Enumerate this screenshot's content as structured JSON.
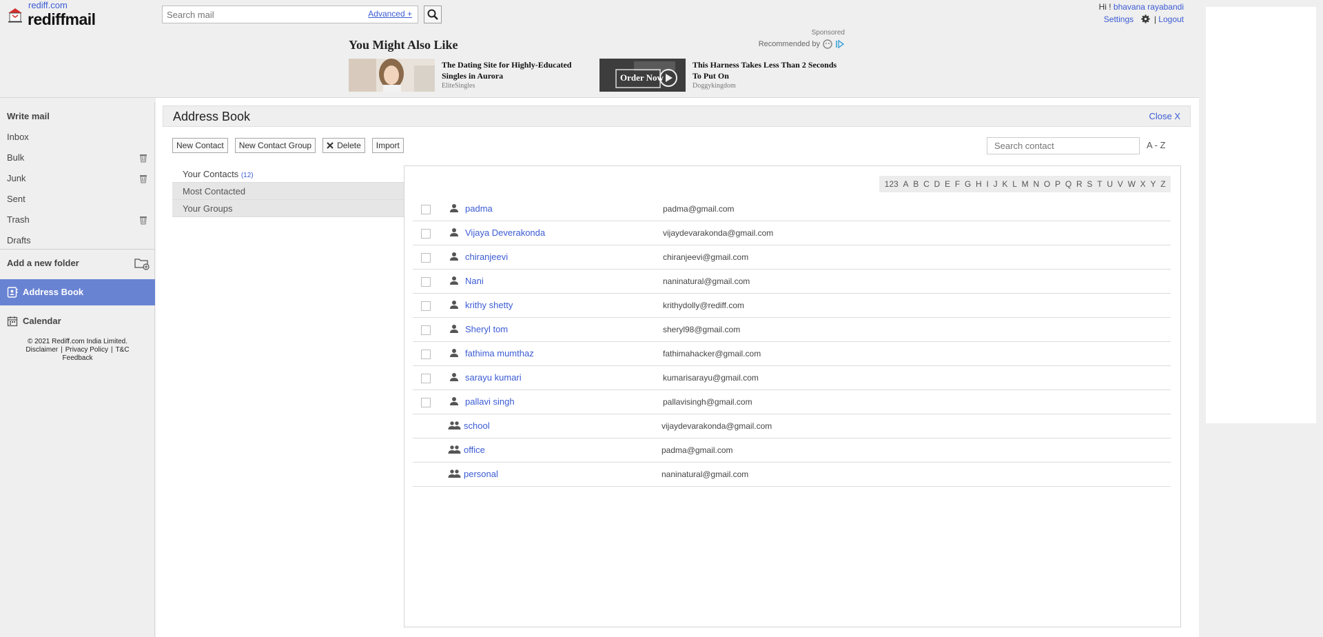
{
  "header": {
    "site_link": "rediff.com",
    "brand": "rediffmail",
    "search_placeholder": "Search mail",
    "advanced_label": "Advanced +",
    "greeting": "Hi !",
    "username": "bhavana rayabandi",
    "settings_label": "Settings",
    "separator": "|",
    "logout_label": "Logout"
  },
  "ads": {
    "heading": "You Might Also Like",
    "sponsored_label": "Sponsored",
    "recommended_label": "Recommended by",
    "items": [
      {
        "title": "The Dating Site for Highly-Educated Singles in Aurora",
        "source": "EliteSingles"
      },
      {
        "title": "This Harness Takes Less Than 2 Seconds To Put On",
        "source": "Doggykingdom",
        "overlay": "Order Now"
      }
    ]
  },
  "sidebar": {
    "write_mail": "Write mail",
    "folders": [
      {
        "label": "Inbox",
        "has_trash": false
      },
      {
        "label": "Bulk",
        "has_trash": true
      },
      {
        "label": "Junk",
        "has_trash": true
      },
      {
        "label": "Sent",
        "has_trash": false
      },
      {
        "label": "Trash",
        "has_trash": true
      },
      {
        "label": "Drafts",
        "has_trash": false
      }
    ],
    "add_folder": "Add a new folder",
    "address_book": "Address Book",
    "calendar": "Calendar",
    "footer": {
      "copyright": "© 2021 Rediff.com India Limited.",
      "disclaimer": "Disclaimer",
      "privacy": "Privacy Policy",
      "tc": "T&C",
      "sep": "|",
      "feedback": "Feedback"
    }
  },
  "address_book": {
    "title": "Address Book",
    "close_label": "Close X",
    "toolbar": {
      "new_contact": "New Contact",
      "new_group": "New Contact Group",
      "delete": "Delete",
      "import": "Import"
    },
    "search_placeholder": "Search contact",
    "az_label": "A - Z",
    "lists": {
      "your_contacts": "Your Contacts",
      "your_contacts_count": "(12)",
      "most_contacted": "Most Contacted",
      "your_groups": "Your Groups"
    },
    "alphabet": [
      "123",
      "A",
      "B",
      "C",
      "D",
      "E",
      "F",
      "G",
      "H",
      "I",
      "J",
      "K",
      "L",
      "M",
      "N",
      "O",
      "P",
      "Q",
      "R",
      "S",
      "T",
      "U",
      "V",
      "W",
      "X",
      "Y",
      "Z"
    ],
    "contacts": [
      {
        "name": "padma",
        "email": "padma@gmail.com"
      },
      {
        "name": "Vijaya Deverakonda",
        "email": "vijaydevarakonda@gmail.com"
      },
      {
        "name": "chiranjeevi",
        "email": "chiranjeevi@gmail.com"
      },
      {
        "name": "Nani",
        "email": "naninatural@gmail.com"
      },
      {
        "name": "krithy shetty",
        "email": "krithydolly@rediff.com"
      },
      {
        "name": "Sheryl tom",
        "email": "sheryl98@gmail.com"
      },
      {
        "name": "fathima mumthaz",
        "email": "fathimahacker@gmail.com"
      },
      {
        "name": "sarayu kumari",
        "email": "kumarisarayu@gmail.com"
      },
      {
        "name": "pallavi singh",
        "email": "pallavisingh@gmail.com"
      }
    ],
    "groups": [
      {
        "name": "school",
        "email": "vijaydevarakonda@gmail.com"
      },
      {
        "name": "office",
        "email": "padma@gmail.com"
      },
      {
        "name": "personal",
        "email": "naninatural@gmail.com"
      }
    ]
  },
  "colors": {
    "accent": "#6983d3",
    "link": "#3b5bd3",
    "logo_red": "#d32f2f"
  }
}
